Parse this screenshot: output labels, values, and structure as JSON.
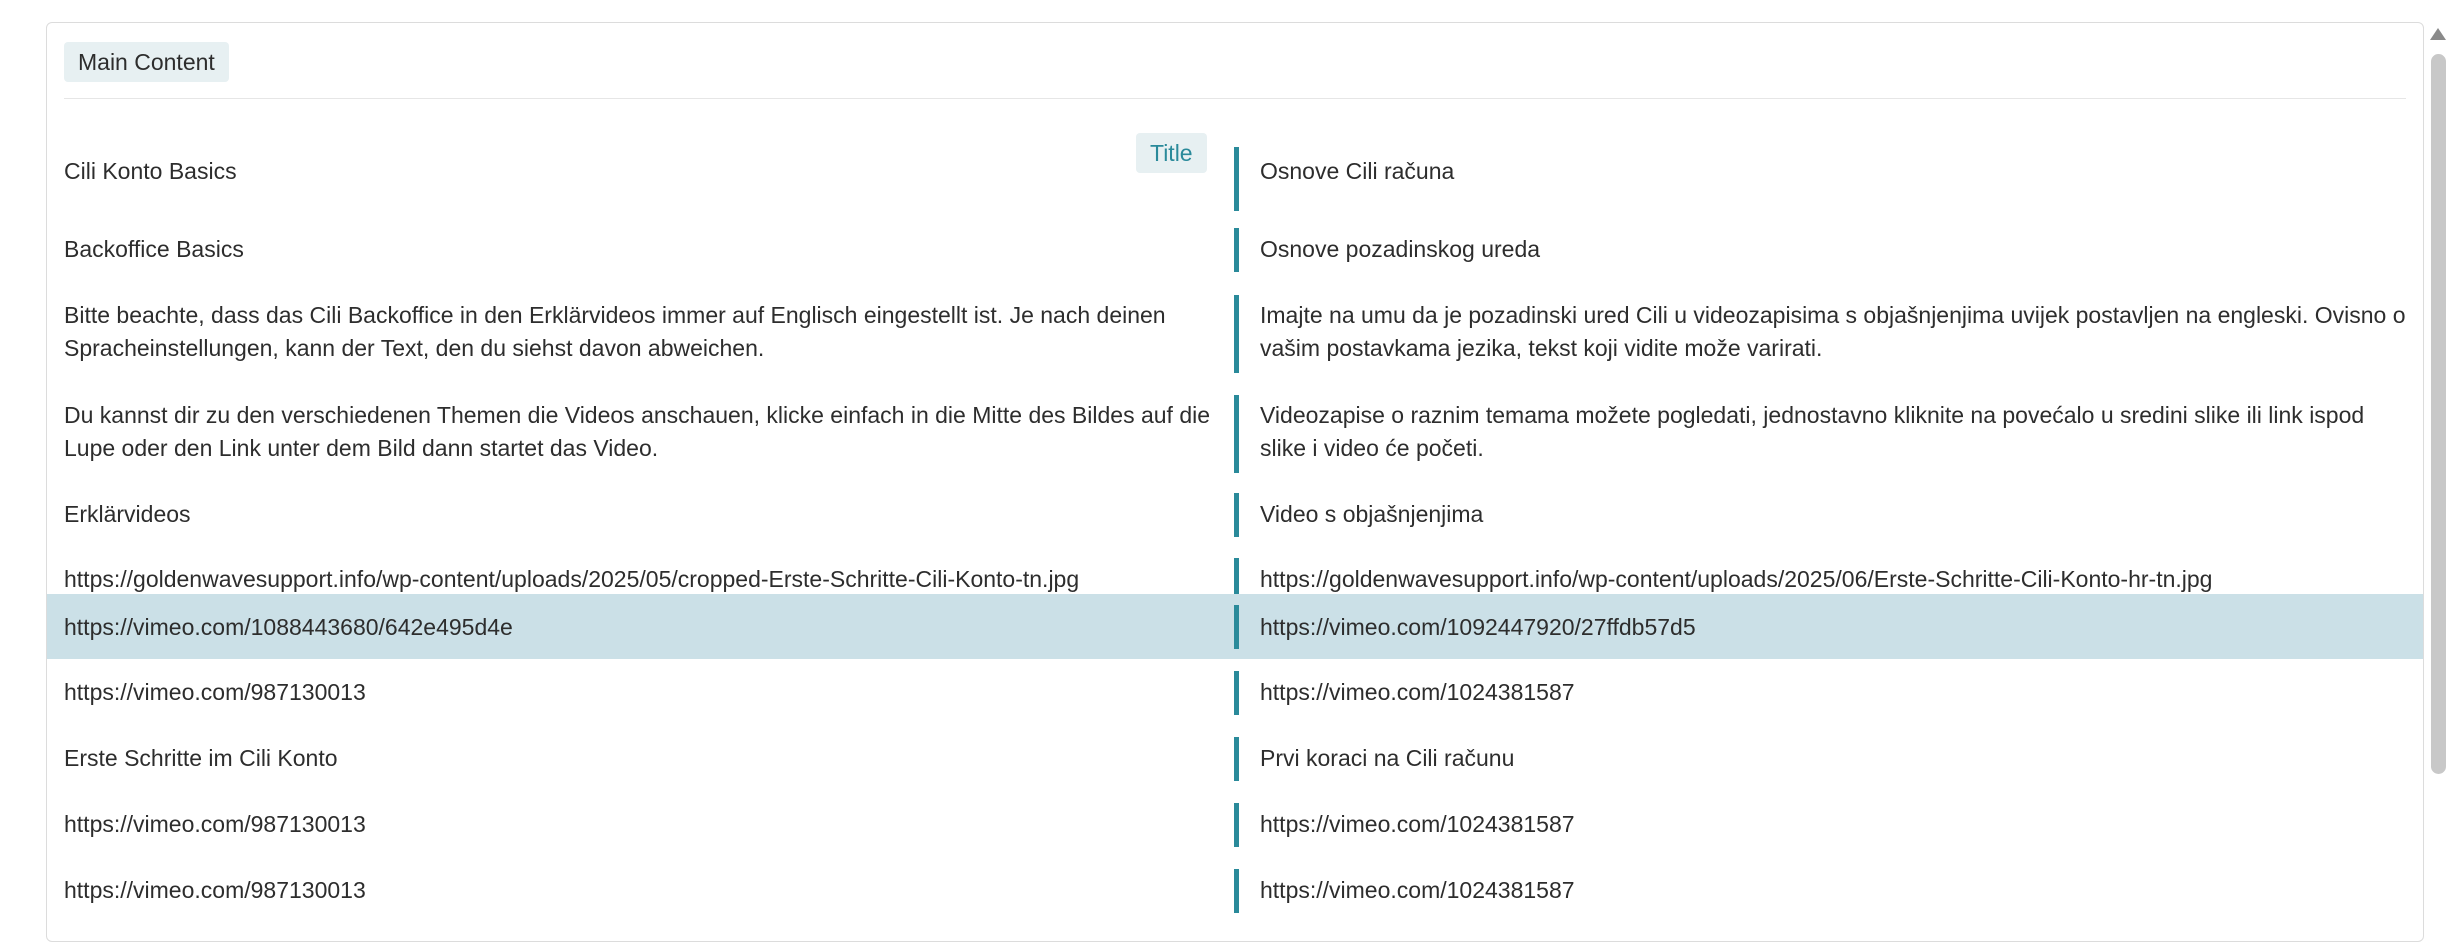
{
  "header": {
    "badge": "Main Content"
  },
  "title_tag": "Title",
  "rows": [
    {
      "source": "Cili Konto Basics",
      "target": "Osnove Cili računa"
    },
    {
      "source": "Backoffice Basics",
      "target": "Osnove pozadinskog ureda"
    },
    {
      "source": "Bitte beachte, dass das Cili Backoffice in den Erklärvideos immer auf Englisch eingestellt ist. Je nach deinen Spracheinstellungen, kann der Text, den du siehst davon abweichen.",
      "target": "Imajte na umu da je pozadinski ured Cili u videozapisima s objašnjenjima uvijek postavljen na engleski. Ovisno o vašim postavkama jezika, tekst koji vidite može varirati."
    },
    {
      "source": "Du kannst dir zu den verschiedenen Themen die Videos anschauen, klicke einfach in die Mitte des Bildes auf die Lupe oder den Link unter dem Bild dann startet das Video.",
      "target": "Videozapise o raznim temama možete pogledati, jednostavno kliknite na povećalo u sredini slike ili link ispod slike i video će početi."
    },
    {
      "source": "Erklärvideos",
      "target": "Video s objašnjenjima"
    },
    {
      "source": "https://goldenwavesupport.info/wp-content/uploads/2025/05/cropped-Erste-Schritte-Cili-Konto-tn.jpg",
      "target": "https://goldenwavesupport.info/wp-content/uploads/2025/06/Erste-Schritte-Cili-Konto-hr-tn.jpg"
    },
    {
      "source": "https://vimeo.com/1088443680/642e495d4e",
      "target": "https://vimeo.com/1092447920/27ffdb57d5"
    },
    {
      "source": "https://vimeo.com/987130013",
      "target": "https://vimeo.com/1024381587"
    },
    {
      "source": "Erste Schritte im Cili Konto",
      "target": "Prvi koraci na Cili računu"
    },
    {
      "source": "https://vimeo.com/987130013",
      "target": "https://vimeo.com/1024381587"
    },
    {
      "source": "https://vimeo.com/987130013",
      "target": "https://vimeo.com/1024381587"
    }
  ],
  "colors": {
    "accent": "#2a8a9a",
    "selected_row": "#cbe0e7",
    "badge_bg": "#e7f0f2"
  }
}
